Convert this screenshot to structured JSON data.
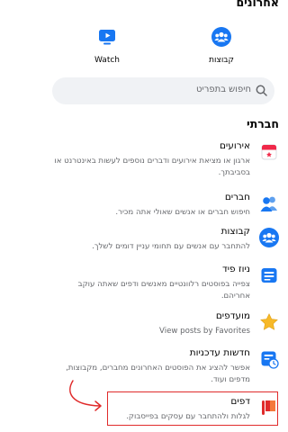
{
  "sections": {
    "recent": "אחרונים",
    "social": "חברתי"
  },
  "shortcuts": [
    {
      "label": "קבוצות",
      "icon": "groups-icon"
    },
    {
      "label": "Watch",
      "icon": "watch-icon"
    }
  ],
  "search": {
    "placeholder": "חיפוש בתפריט"
  },
  "items": [
    {
      "title": "אירועים",
      "desc": "ארגון או מציאת אירועים ודברים נוספים לעשות באינטרנט או בסביבתך.",
      "icon": "calendar-icon"
    },
    {
      "title": "חברים",
      "desc": "חיפוש חברים או אנשים שאולי אתה מכיר.",
      "icon": "friends-icon"
    },
    {
      "title": "קבוצות",
      "desc": "להתחבר עם אנשים עם תחומי עניין דומים לשלך.",
      "icon": "groups-icon"
    },
    {
      "title": "ניוז פיד",
      "desc": "צפייה בפוסטים רלוונטיים מאנשים ודפים שאתה עוקב אחריהם.",
      "icon": "news-feed-icon"
    },
    {
      "title": "מועדפים",
      "desc": "View posts by Favorites",
      "icon": "star-icon"
    },
    {
      "title": "חדשות עדכניות",
      "desc": "אפשר להציג את הפוסטים האחרונים מחברים, מקבוצות, מדפים ועוד.",
      "icon": "recent-news-icon"
    },
    {
      "title": "דפים",
      "desc": "לגלות ולהתחבר עם עסקים בפייסבוק.",
      "icon": "pages-flag-icon"
    }
  ],
  "colors": {
    "accent": "#1877f2",
    "highlight": "#e02b2b",
    "star": "#f7b928",
    "calendar": "#f02849"
  }
}
